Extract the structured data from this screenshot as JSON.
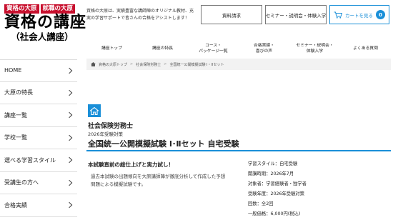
{
  "logo": {
    "tag1": "資格の大原",
    "tag2": "就職の大原",
    "main": "資格の講座",
    "sub": "（社会人講座）"
  },
  "tagline": "資格の大原は、実績豊富な講師陣のオリジナル教材、充実の学習サポートで皆さんの合格をアシストします！",
  "header_buttons": {
    "request": "資料請求",
    "seminar": "セミナー・説明会・体験入学",
    "cart_label": "カートを見る",
    "cart_count": "0"
  },
  "nav": {
    "items": [
      "講座トップ",
      "講座の特長",
      "コース・\nパッケージ一覧",
      "合格実績・\n喜びの声",
      "セミナー・説明会・\n体験入学",
      "よくある質問"
    ]
  },
  "breadcrumb": {
    "items": [
      "資格の大原トップ",
      "社会保険労務士",
      "全国統一公開模擬試験 I・IIセット"
    ]
  },
  "sidebar": {
    "items": [
      "HOME",
      "大原の特長",
      "講座一覧",
      "学校一覧",
      "選べる学習スタイル",
      "受講生の方へ",
      "合格実績"
    ]
  },
  "product": {
    "category": "社会保険労務士",
    "year": "2026年受験対策",
    "title": "全国統一公開模擬試験 Ⅰ･Ⅱセット 自宅受験",
    "catch": "本試験直前の総仕上げと実力試し！",
    "description": "過去本試験の出題傾向を大原講師陣が徹底分析して作成した予想問題による模擬試験です。",
    "specs": [
      "学習スタイル：自宅受験",
      "開講時期：2026年7月",
      "対象者：学習経験者・独学者",
      "受験年度：2026年受験対策",
      "回数：全2回",
      "一般価格：6,000円(税込)"
    ]
  }
}
